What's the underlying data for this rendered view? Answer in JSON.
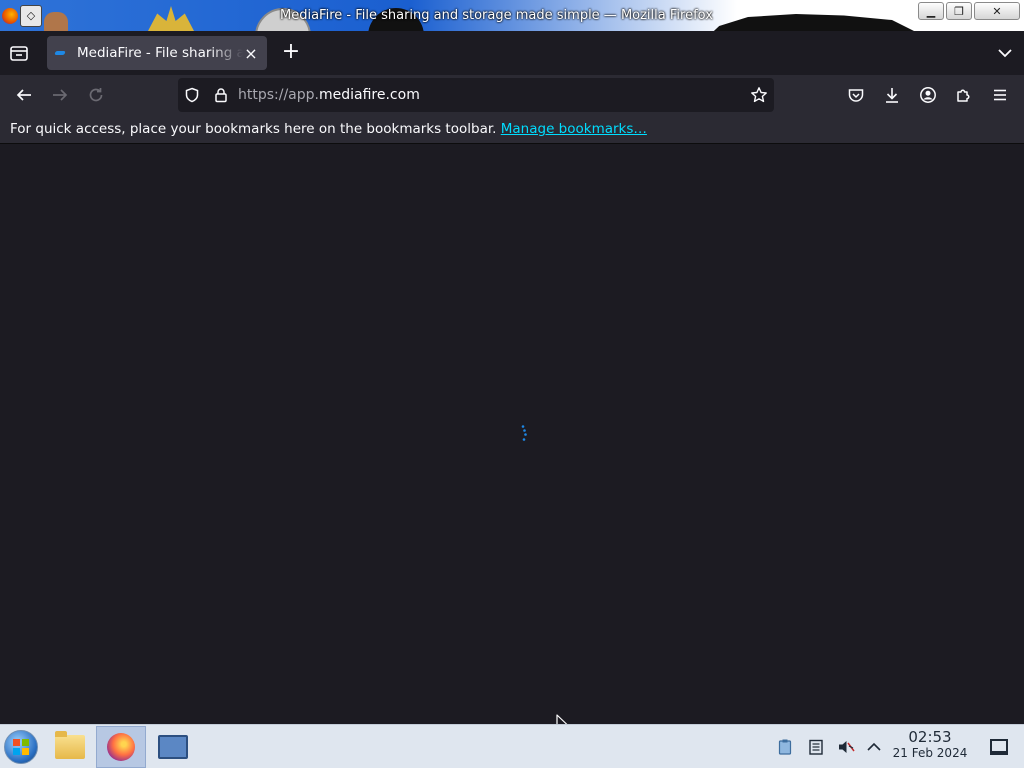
{
  "window": {
    "title": "MediaFire - File sharing and storage made simple — Mozilla Firefox",
    "controls": [
      "minimize-icon",
      "maximize-icon",
      "close-icon"
    ]
  },
  "tabs": [
    {
      "title": "MediaFire - File sharing and storage made simple",
      "active": true,
      "favicon": "mediafire-icon"
    }
  ],
  "toolbar": {
    "url_scheme": "https://app.",
    "url_domain": "mediafire.com",
    "icons": [
      "back-icon",
      "forward-icon",
      "reload-icon",
      "shield-icon",
      "lock-icon",
      "bookmark-star-icon",
      "pocket-icon",
      "downloads-icon",
      "account-icon",
      "extensions-icon",
      "menu-icon"
    ]
  },
  "bookmarks_bar": {
    "message": "For quick access, place your bookmarks here on the bookmarks toolbar.",
    "link_label": "Manage bookmarks…"
  },
  "content": {
    "state": "loading",
    "spinner_color": "#1e88e5"
  },
  "taskbar": {
    "apps": [
      "file-manager-icon",
      "firefox-icon",
      "system-monitor-icon"
    ],
    "active_app": "firefox-icon",
    "tray": [
      "clipboard-icon",
      "notes-icon",
      "speaker-muted-icon",
      "chevron-up-icon"
    ],
    "clock": {
      "time": "02:53",
      "date": "21 Feb 2024"
    }
  },
  "colors": {
    "chrome_bg": "#1c1b22",
    "toolbar_bg": "#2b2a33",
    "tab_active_bg": "#42414d",
    "link": "#00ddff",
    "taskbar_bg": "#dfe6ef"
  }
}
